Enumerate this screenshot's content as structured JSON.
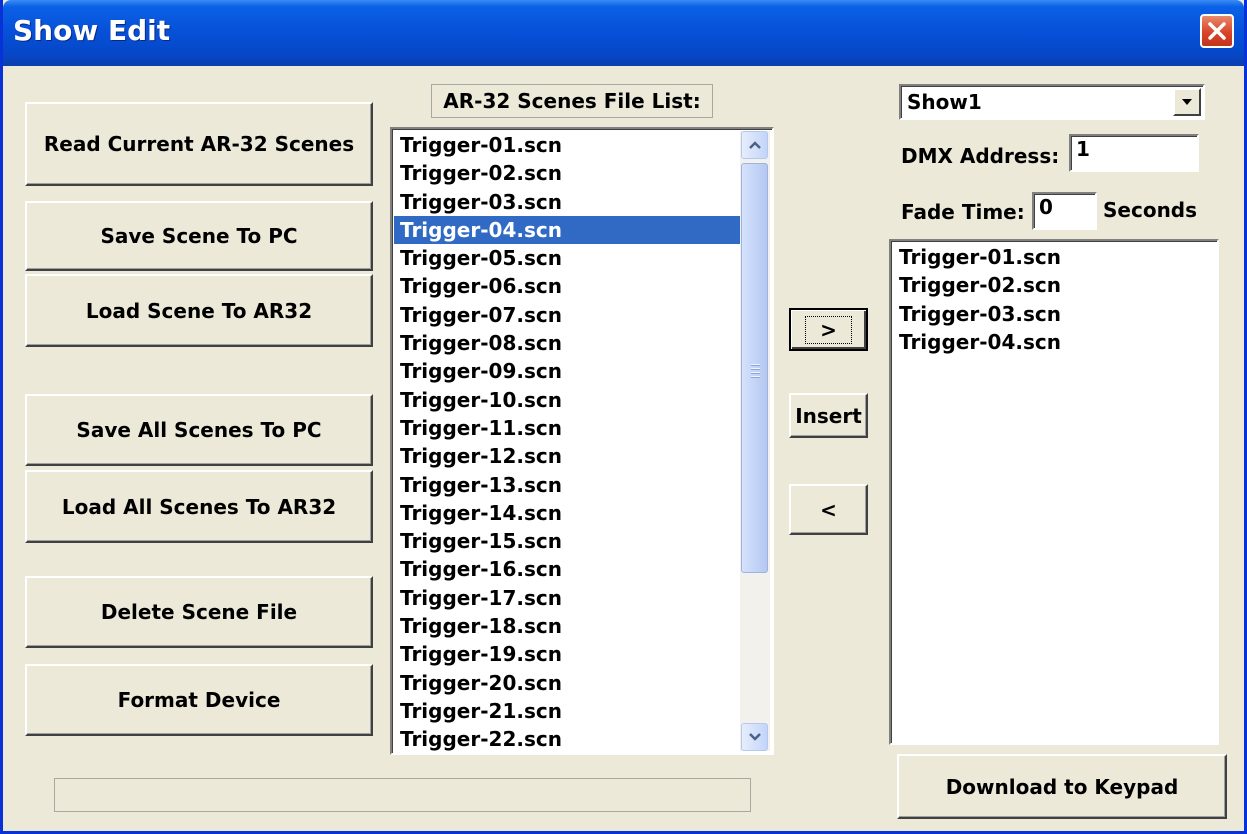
{
  "window": {
    "title": "Show Edit"
  },
  "left_buttons": {
    "read_current": "Read Current AR-32 Scenes",
    "save_scene": "Save Scene To PC",
    "load_scene": "Load Scene To AR32",
    "save_all": "Save All Scenes To PC",
    "load_all": "Load All Scenes To AR32",
    "delete_file": "Delete Scene File",
    "format_device": "Format Device"
  },
  "scene_list": {
    "label": "AR-32 Scenes File List:",
    "items": [
      "Trigger-01.scn",
      "Trigger-02.scn",
      "Trigger-03.scn",
      "Trigger-04.scn",
      "Trigger-05.scn",
      "Trigger-06.scn",
      "Trigger-07.scn",
      "Trigger-08.scn",
      "Trigger-09.scn",
      "Trigger-10.scn",
      "Trigger-11.scn",
      "Trigger-12.scn",
      "Trigger-13.scn",
      "Trigger-14.scn",
      "Trigger-15.scn",
      "Trigger-16.scn",
      "Trigger-17.scn",
      "Trigger-18.scn",
      "Trigger-19.scn",
      "Trigger-20.scn",
      "Trigger-21.scn",
      "Trigger-22.scn"
    ],
    "selected_item": "Trigger-04.scn",
    "selection_color": "#316ac5"
  },
  "middle_buttons": {
    "add": ">",
    "insert": "Insert",
    "remove": "<"
  },
  "show": {
    "selected": "Show1",
    "dmx_label": "DMX Address:",
    "dmx_value": "1",
    "fade_label": "Fade Time:",
    "fade_value": "0",
    "fade_unit": "Seconds",
    "items": [
      "Trigger-01.scn",
      "Trigger-02.scn",
      "Trigger-03.scn",
      "Trigger-04.scn"
    ],
    "download_label": "Download to Keypad"
  },
  "colors": {
    "titlebar": "#0751d9",
    "close": "#d9442a",
    "dialog_bg": "#ece9d8"
  },
  "icons": {
    "close": "close-icon",
    "dropdown": "chevron-down-icon",
    "scroll_up": "arrow-up-icon",
    "scroll_down": "arrow-down-icon"
  }
}
